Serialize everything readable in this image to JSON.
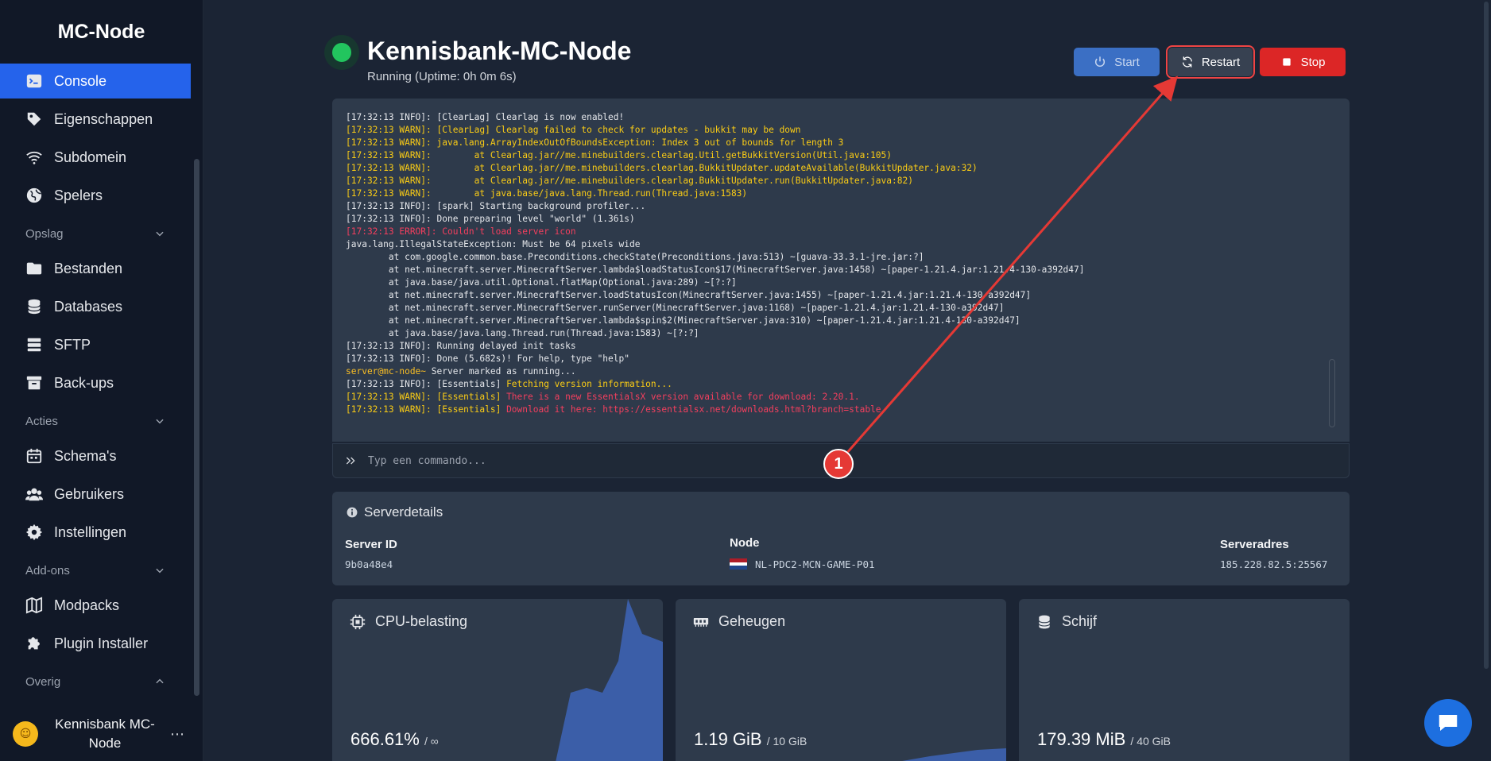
{
  "brand": "MC-Node",
  "sidebar": {
    "items": [
      {
        "label": "Console",
        "icon": "terminal-icon"
      },
      {
        "label": "Eigenschappen",
        "icon": "tag-icon"
      },
      {
        "label": "Subdomein",
        "icon": "wifi-icon"
      },
      {
        "label": "Spelers",
        "icon": "globe-icon"
      }
    ],
    "sections": [
      {
        "label": "Opslag",
        "items": [
          {
            "label": "Bestanden",
            "icon": "folder-icon"
          },
          {
            "label": "Databases",
            "icon": "database-icon"
          },
          {
            "label": "SFTP",
            "icon": "server-stack-icon"
          },
          {
            "label": "Back-ups",
            "icon": "archive-icon"
          }
        ]
      },
      {
        "label": "Acties",
        "items": [
          {
            "label": "Schema's",
            "icon": "calendar-icon"
          },
          {
            "label": "Gebruikers",
            "icon": "users-icon"
          },
          {
            "label": "Instellingen",
            "icon": "gear-icon"
          }
        ]
      },
      {
        "label": "Add-ons",
        "items": [
          {
            "label": "Modpacks",
            "icon": "map-icon"
          },
          {
            "label": "Plugin Installer",
            "icon": "puzzle-icon"
          }
        ]
      },
      {
        "label": "Overig",
        "items": []
      }
    ],
    "user": {
      "name_line1": "Kennisbank MC-",
      "name_line2": "Node",
      "more": "⋯"
    }
  },
  "header": {
    "title": "Kennisbank-MC-Node",
    "status": "Running (Uptime: 0h 0m 6s)",
    "buttons": {
      "start": "Start",
      "restart": "Restart",
      "stop": "Stop"
    }
  },
  "console": {
    "lines": [
      {
        "text": "[17:32:13 INFO]: [ClearLag] Clearlag is now enabled!",
        "level": "info"
      },
      {
        "text": "[17:32:13 WARN]: [ClearLag] Clearlag failed to check for updates - bukkit may be down",
        "level": "warn"
      },
      {
        "text": "[17:32:13 WARN]: java.lang.ArrayIndexOutOfBoundsException: Index 3 out of bounds for length 3",
        "level": "warn"
      },
      {
        "text": "[17:32:13 WARN]:        at Clearlag.jar//me.minebuilders.clearlag.Util.getBukkitVersion(Util.java:105)",
        "level": "warn"
      },
      {
        "text": "[17:32:13 WARN]:        at Clearlag.jar//me.minebuilders.clearlag.BukkitUpdater.updateAvailable(BukkitUpdater.java:32)",
        "level": "warn"
      },
      {
        "text": "[17:32:13 WARN]:        at Clearlag.jar//me.minebuilders.clearlag.BukkitUpdater.run(BukkitUpdater.java:82)",
        "level": "warn"
      },
      {
        "text": "[17:32:13 WARN]:        at java.base/java.lang.Thread.run(Thread.java:1583)",
        "level": "warn"
      },
      {
        "text": "[17:32:13 INFO]: [spark] Starting background profiler...",
        "level": "info"
      },
      {
        "text": "[17:32:13 INFO]: Done preparing level \"world\" (1.361s)",
        "level": "info"
      },
      {
        "text": "[17:32:13 ERROR]: Couldn't load server icon",
        "level": "error"
      },
      {
        "text": "java.lang.IllegalStateException: Must be 64 pixels wide",
        "level": "info"
      },
      {
        "text": "        at com.google.common.base.Preconditions.checkState(Preconditions.java:513) ~[guava-33.3.1-jre.jar:?]",
        "level": "info"
      },
      {
        "text": "        at net.minecraft.server.MinecraftServer.lambda$loadStatusIcon$17(MinecraftServer.java:1458) ~[paper-1.21.4.jar:1.21.4-130-a392d47]",
        "level": "info"
      },
      {
        "text": "        at java.base/java.util.Optional.flatMap(Optional.java:289) ~[?:?]",
        "level": "info"
      },
      {
        "text": "        at net.minecraft.server.MinecraftServer.loadStatusIcon(MinecraftServer.java:1455) ~[paper-1.21.4.jar:1.21.4-130-a392d47]",
        "level": "info"
      },
      {
        "text": "        at net.minecraft.server.MinecraftServer.runServer(MinecraftServer.java:1168) ~[paper-1.21.4.jar:1.21.4-130-a392d47]",
        "level": "info"
      },
      {
        "text": "        at net.minecraft.server.MinecraftServer.lambda$spin$2(MinecraftServer.java:310) ~[paper-1.21.4.jar:1.21.4-130-a392d47]",
        "level": "info"
      },
      {
        "text": "        at java.base/java.lang.Thread.run(Thread.java:1583) ~[?:?]",
        "level": "info"
      },
      {
        "text": "[17:32:13 INFO]: Running delayed init tasks",
        "level": "info"
      },
      {
        "text": "[17:32:13 INFO]: Done (5.682s)! For help, type \"help\"",
        "level": "info"
      },
      {
        "text": "server@mc-node~ Server marked as running...",
        "level": "prompt"
      },
      {
        "text": "[17:32:13 INFO]: [Essentials] Fetching version information...",
        "level": "ess-info"
      },
      {
        "text": "[17:32:13 WARN]: [Essentials] There is a new EssentialsX version available for download: 2.20.1.",
        "level": "ess-warn"
      },
      {
        "text": "[17:32:13 WARN]: [Essentials] Download it here: https://essentialsx.net/downloads.html?branch=stable",
        "level": "ess-warn"
      }
    ],
    "command_placeholder": "Typ een commando..."
  },
  "details": {
    "title": "Serverdetails",
    "server_id_label": "Server ID",
    "server_id": "9b0a48e4",
    "node_label": "Node",
    "node": "NL-PDC2-MCN-GAME-P01",
    "address_label": "Serveradres",
    "address": "185.228.82.5:25567"
  },
  "stats": {
    "cpu": {
      "title": "CPU-belasting",
      "value": "666.61%",
      "limit": "/ ∞"
    },
    "memory": {
      "title": "Geheugen",
      "value": "1.19 GiB",
      "limit": "/ 10 GiB"
    },
    "disk": {
      "title": "Schijf",
      "value": "179.39 MiB",
      "limit": "/ 40 GiB"
    }
  },
  "annotation": {
    "label": "1"
  },
  "colors": {
    "accent": "#2563eb",
    "running": "#22c55e",
    "stop": "#dc2626",
    "annotation": "#e53935"
  }
}
